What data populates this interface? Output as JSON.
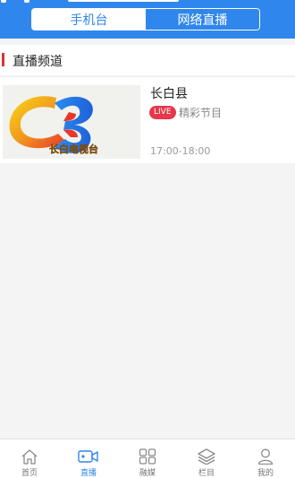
{
  "header": {
    "segments": [
      {
        "label": "手机台",
        "active": true
      },
      {
        "label": "网络直播",
        "active": false
      }
    ],
    "accent_color": "#2f86ec"
  },
  "section": {
    "title": "直播频道",
    "marker_color": "#e03333"
  },
  "channels": [
    {
      "name": "长白县",
      "badge": "LIVE",
      "program": "精彩节目",
      "time": "17:00-18:00",
      "thumbnail_text": "长白电视台",
      "thumbnail_icon": "tv-station-logo"
    }
  ],
  "tabbar": {
    "items": [
      {
        "label": "首页",
        "icon": "home-icon",
        "active": false
      },
      {
        "label": "直播",
        "icon": "video-camera-icon",
        "active": true
      },
      {
        "label": "融媒",
        "icon": "grid-icon",
        "active": false
      },
      {
        "label": "栏目",
        "icon": "layers-icon",
        "active": false
      },
      {
        "label": "我的",
        "icon": "user-icon",
        "active": false
      }
    ]
  }
}
